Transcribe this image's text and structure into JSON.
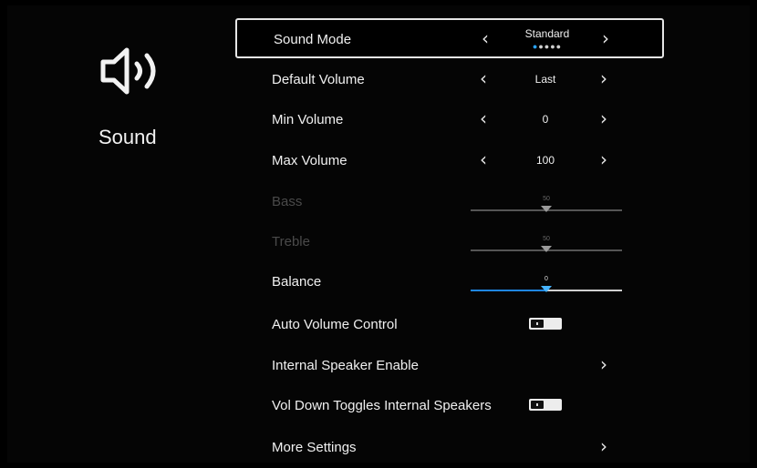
{
  "page": {
    "title": "Sound",
    "icon": "speaker-volume-icon"
  },
  "menu": {
    "sound_mode": {
      "label": "Sound Mode",
      "value": "Standard",
      "dots": [
        "on",
        "off",
        "off",
        "off",
        "off"
      ]
    },
    "default_volume": {
      "label": "Default Volume",
      "value": "Last"
    },
    "min_volume": {
      "label": "Min Volume",
      "value": "0"
    },
    "max_volume": {
      "label": "Max Volume",
      "value": "100"
    },
    "bass": {
      "label": "Bass",
      "value": "50",
      "level": 0.5,
      "enabled": false
    },
    "treble": {
      "label": "Treble",
      "value": "50",
      "level": 0.5,
      "enabled": false
    },
    "balance": {
      "label": "Balance",
      "value": "0",
      "level": 0.5,
      "enabled": true
    },
    "auto_volume": {
      "label": "Auto Volume Control",
      "on": false
    },
    "internal_speaker": {
      "label": "Internal Speaker Enable"
    },
    "vol_down_toggles": {
      "label": "Vol Down Toggles Internal Speakers",
      "on": false
    },
    "more_settings": {
      "label": "More Settings"
    }
  },
  "colors": {
    "accent": "#1f86e0",
    "dot_active": "#29a3ff",
    "text": "#f0f0f0",
    "disabled": "#4a4a4a"
  }
}
